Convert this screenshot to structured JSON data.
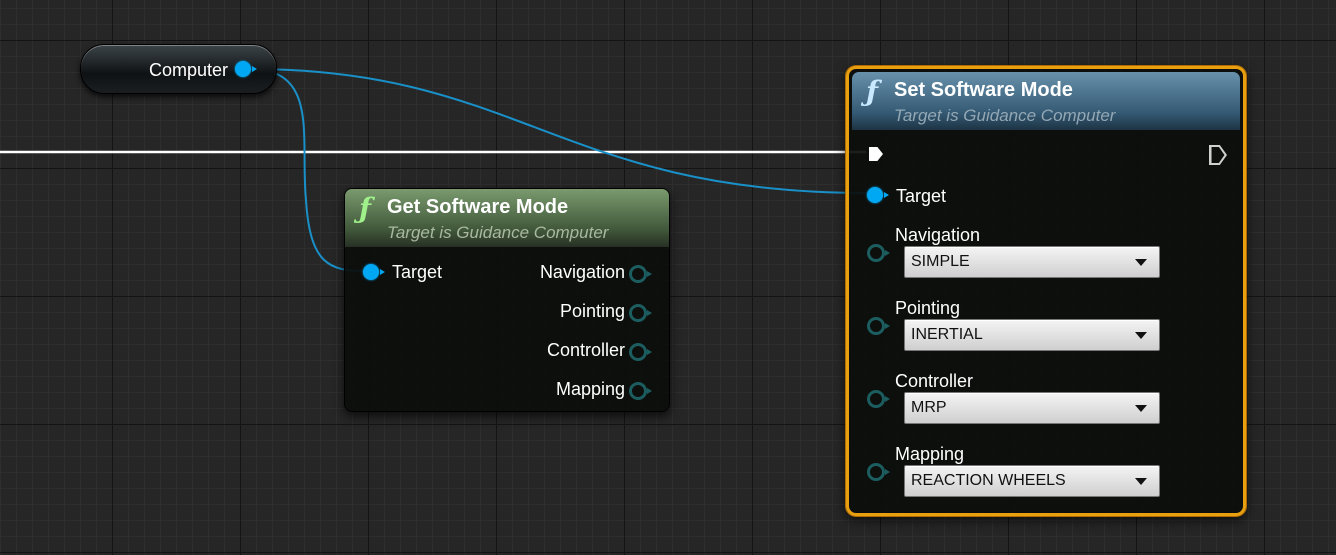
{
  "variable_node": {
    "label": "Computer"
  },
  "get_node": {
    "title": "Get Software Mode",
    "subtitle": "Target is Guidance Computer",
    "input_pin": "Target",
    "outputs": [
      "Navigation",
      "Pointing",
      "Controller",
      "Mapping"
    ]
  },
  "set_node": {
    "title": "Set Software Mode",
    "subtitle": "Target is Guidance Computer",
    "target_pin": "Target",
    "params": [
      {
        "label": "Navigation",
        "value": "SIMPLE"
      },
      {
        "label": "Pointing",
        "value": "INERTIAL"
      },
      {
        "label": "Controller",
        "value": "MRP"
      },
      {
        "label": "Mapping",
        "value": "REACTION WHEELS"
      }
    ]
  },
  "colors": {
    "object_pin": "#00a8f3",
    "struct_pin": "#1c5d5f",
    "selection_outline": "#e8a010",
    "get_header": "#5d7a50",
    "set_header": "#4a7592",
    "exec_wire": "#ffffff"
  },
  "icons": {
    "function": "function-icon"
  }
}
